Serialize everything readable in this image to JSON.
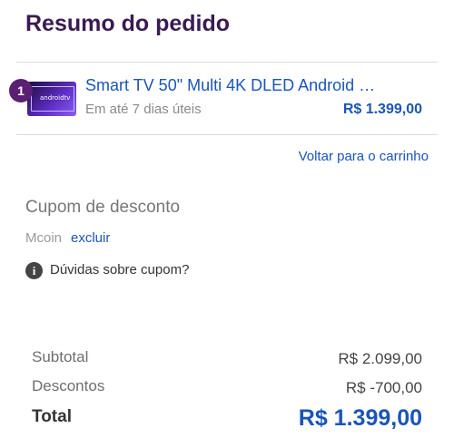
{
  "header": {
    "title": "Resumo do pedido"
  },
  "item": {
    "quantity": "1",
    "thumbnail_logo": "androidtv",
    "name": "Smart TV 50\" Multi 4K DLED Android …",
    "delivery": "Em até 7 dias úteis",
    "price": "R$ 1.399,00"
  },
  "cart": {
    "back_label": "Voltar para o carrinho"
  },
  "coupon": {
    "title": "Cupom de desconto",
    "code": "Mcoin",
    "remove_label": "excluir",
    "help_icon": "info-icon",
    "help_text": "Dúvidas sobre cupom?"
  },
  "summary": {
    "subtotal_label": "Subtotal",
    "subtotal_value": "R$ 2.099,00",
    "discount_label": "Descontos",
    "discount_value": "R$ -700,00",
    "total_label": "Total",
    "total_value": "R$ 1.399,00"
  },
  "colors": {
    "title": "#3b1a52",
    "link": "#1a55b8",
    "badge": "#5b1f73"
  }
}
